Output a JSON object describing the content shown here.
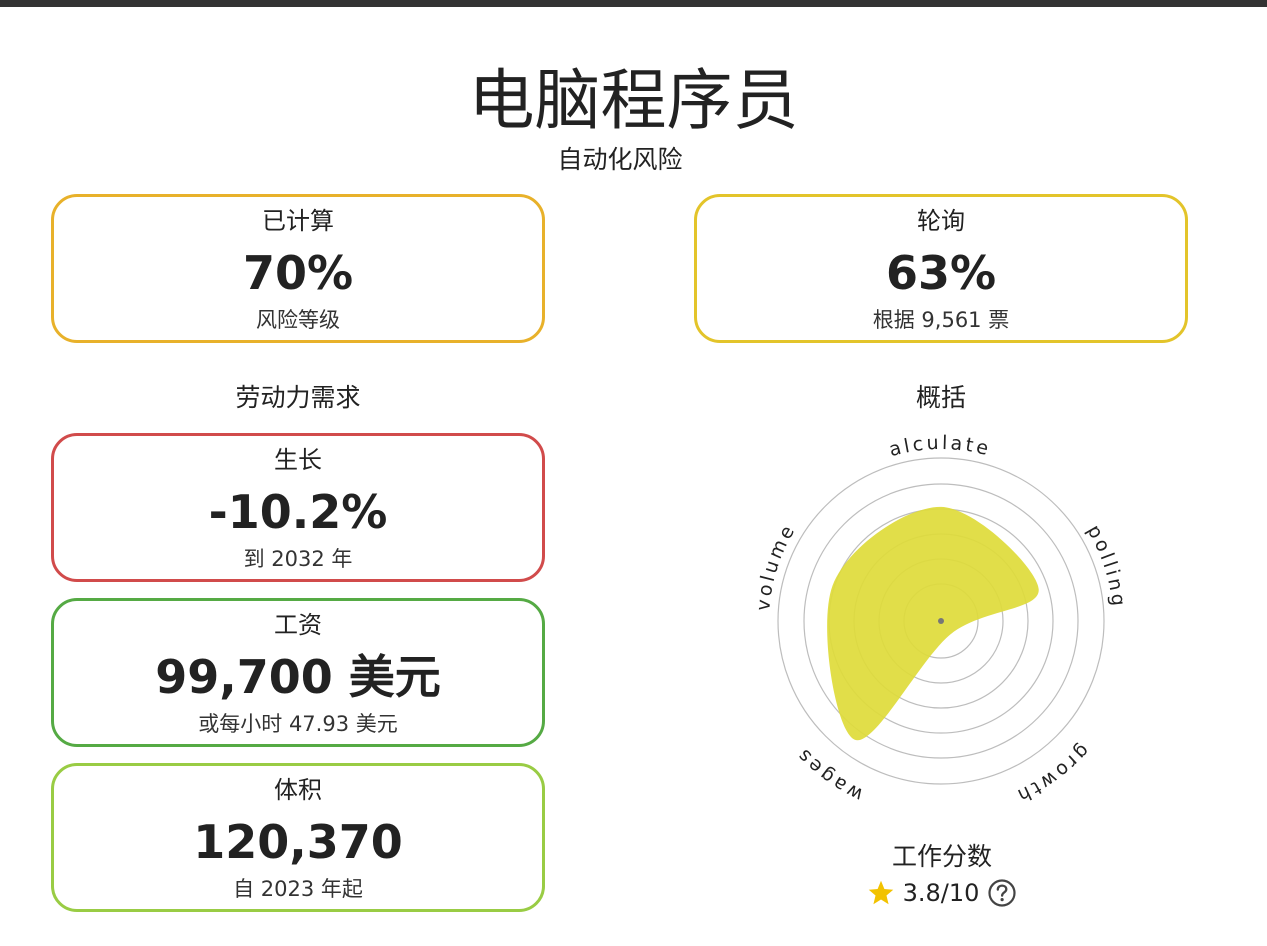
{
  "title": "电脑程序员",
  "automation_risk": {
    "heading": "自动化风险",
    "calculated": {
      "label": "已计算",
      "value": "70%",
      "sub": "风险等级",
      "color": "#e8b12a"
    },
    "polling": {
      "label": "轮询",
      "value": "63%",
      "sub": "根据 9,561 票",
      "color": "#e3c42a"
    }
  },
  "labor_demand": {
    "heading": "劳动力需求",
    "growth": {
      "label": "生长",
      "value": "-10.2%",
      "sub": "到 2032 年",
      "color": "#d14b4b"
    },
    "wages": {
      "label": "工资",
      "value": "99,700 美元",
      "sub": "或每小时 47.93 美元",
      "color": "#55aa44"
    },
    "volume": {
      "label": "体积",
      "value": "120,370",
      "sub": "自 2023 年起",
      "color": "#99cc44"
    }
  },
  "summary": {
    "heading": "概括",
    "radar_labels": [
      "calculated",
      "polling",
      "growth",
      "wages",
      "volume"
    ],
    "radar_values": [
      0.7,
      0.63,
      0.1,
      0.9,
      0.7
    ],
    "fill_color": "#dedb3a"
  },
  "job_score": {
    "heading": "工作分数",
    "value": "3.8/10",
    "star_color": "#f2c200"
  }
}
